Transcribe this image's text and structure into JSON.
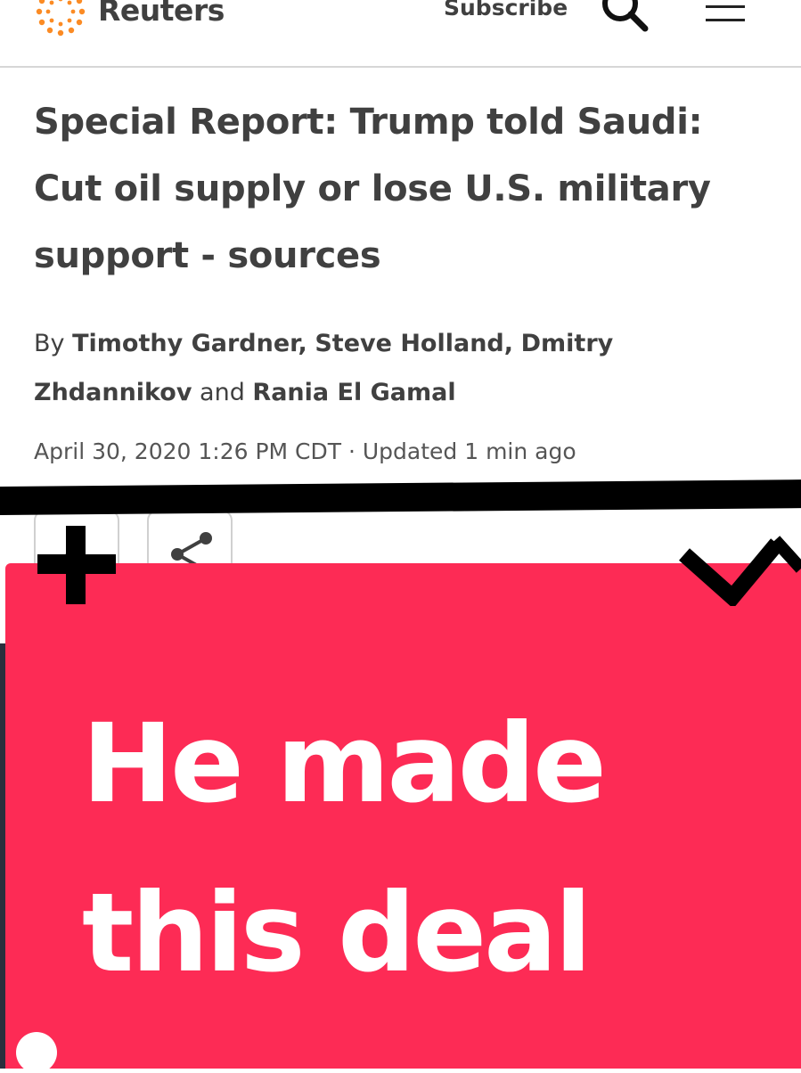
{
  "header": {
    "logo_text": "Reuters",
    "subscribe_label": "Subscribe",
    "search_icon": "search-icon",
    "menu_icon": "hamburger-menu-icon",
    "brand_color": "#fb8b24"
  },
  "article": {
    "headline_lines": [
      "Special Report: Trump told Saudi:",
      "Cut oil supply or lose U.S. military",
      "support - sources"
    ],
    "byline": {
      "prefix": "By",
      "author1": "Timothy Gardner",
      "author2": "Steve Holland",
      "author3_line1": "Dmitry",
      "author3_line2": "Zhdannikov",
      "conjunction": "and",
      "author4": "Rania El Gamal",
      "separator": ","
    },
    "dateline": "April 30, 2020 1:26 PM CDT · Updated 1 min ago"
  },
  "actions": {
    "font_size_icon": "font-size-icon",
    "share_icon": "share-icon"
  },
  "overlay": {
    "line1": "He made",
    "line2": "this deal",
    "background_color": "#fd2b55",
    "text_color": "#ffffff",
    "plus_icon": "plus-icon",
    "chevron_icon": "chevron-down-icon"
  }
}
